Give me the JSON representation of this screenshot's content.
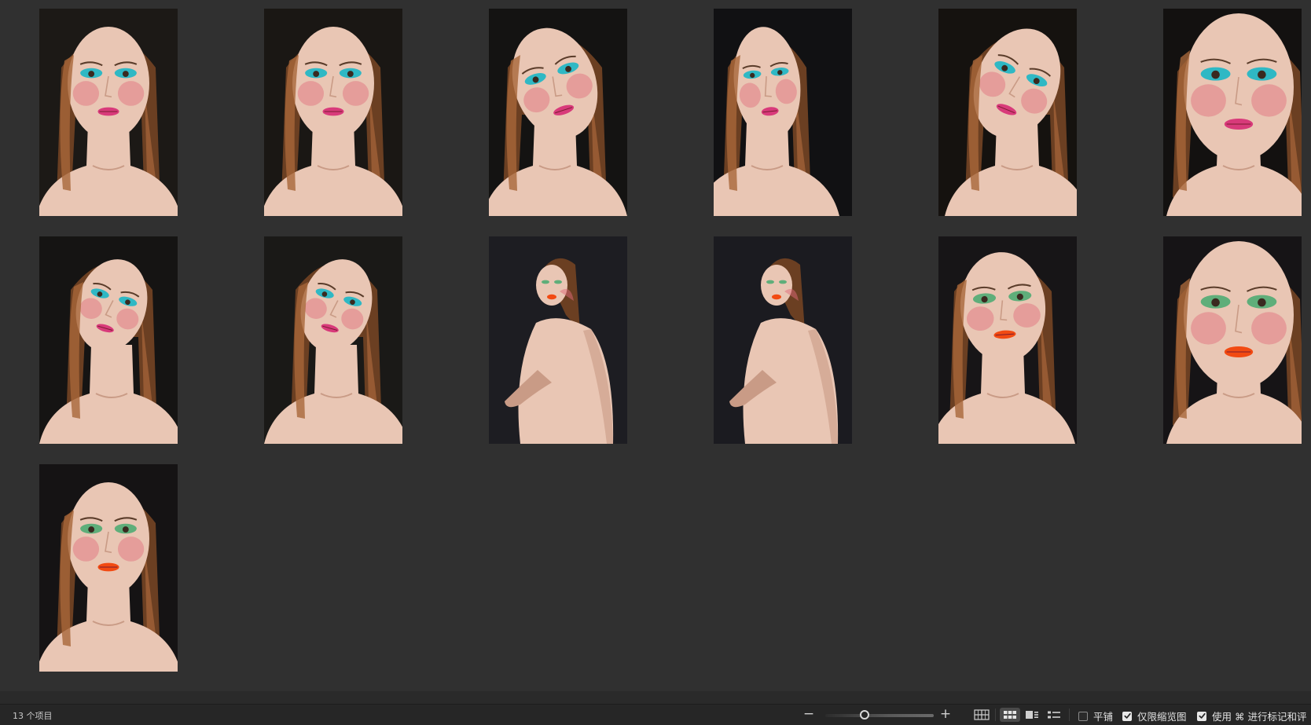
{
  "photos": [
    {
      "id": "photo-1",
      "makeup": "teal-pink",
      "pose": "front",
      "bg": "#1c1916"
    },
    {
      "id": "photo-2",
      "makeup": "teal-pink",
      "pose": "front",
      "bg": "#1a1714"
    },
    {
      "id": "photo-3",
      "makeup": "teal-pink",
      "pose": "tilt-left",
      "bg": "#141312"
    },
    {
      "id": "photo-4",
      "makeup": "teal-pink",
      "pose": "profile",
      "bg": "#111113"
    },
    {
      "id": "photo-5",
      "makeup": "teal-pink",
      "pose": "tilt-right",
      "bg": "#15120f"
    },
    {
      "id": "photo-6",
      "makeup": "teal-pink",
      "pose": "closeup",
      "bg": "#131110"
    },
    {
      "id": "photo-7",
      "makeup": "teal-pink",
      "pose": "tilt-head",
      "bg": "#151413"
    },
    {
      "id": "photo-8",
      "makeup": "teal-pink",
      "pose": "tilt-head",
      "bg": "#1a1917"
    },
    {
      "id": "photo-9",
      "makeup": "green-orange",
      "pose": "back",
      "bg": "#1d1d22"
    },
    {
      "id": "photo-10",
      "makeup": "green-orange",
      "pose": "back",
      "bg": "#1b1b20"
    },
    {
      "id": "photo-11",
      "makeup": "green-orange",
      "pose": "front-shoulder",
      "bg": "#171517"
    },
    {
      "id": "photo-12",
      "makeup": "green-orange",
      "pose": "closeup",
      "bg": "#161416"
    },
    {
      "id": "photo-13",
      "makeup": "green-orange",
      "pose": "front",
      "bg": "#151314"
    }
  ],
  "status": {
    "item_count": "13 个项目",
    "zoom_minus": "−",
    "zoom_plus": "+",
    "zoom_level": 0.36,
    "options": {
      "tile": "平铺",
      "thumbnails_only": "仅限缩览图",
      "use_cmd_mark": "使用 ⌘ 进行标记和评"
    },
    "checked": {
      "tile": false,
      "thumbnails_only": true,
      "use_cmd_mark": true
    }
  },
  "palette": {
    "skin": "#e9c6b4",
    "skin_shadow": "#c99b86",
    "hair": "#6b3f22",
    "hair_light": "#a8663a",
    "teal": "#2fb8c4",
    "pink_lip": "#d83a7a",
    "orange_lip": "#f24a12",
    "green_eye": "#5fae7a",
    "blush": "#e06a7a"
  }
}
